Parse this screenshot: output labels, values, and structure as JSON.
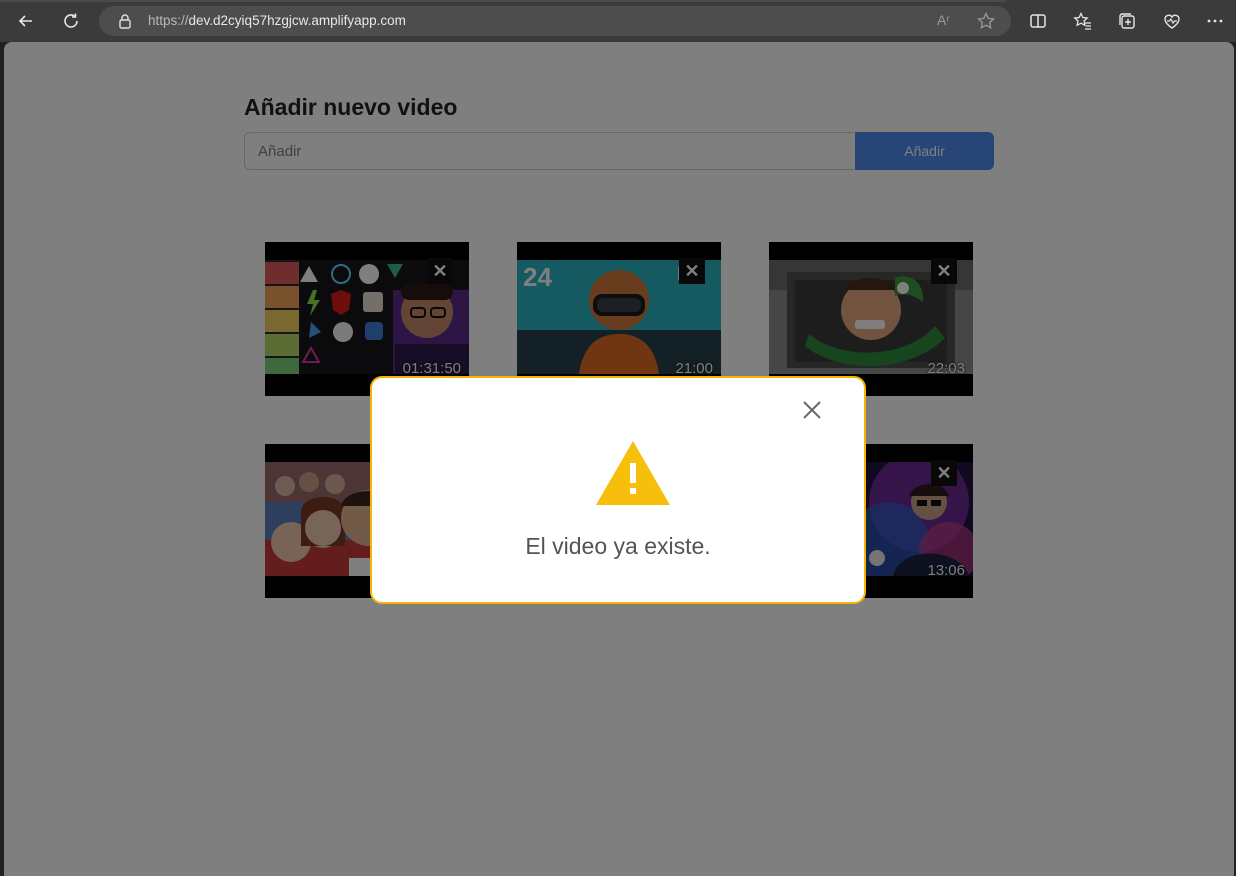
{
  "browser": {
    "url_scheme": "https://",
    "url_host": "dev.d2cyiq57hzgjcw.amplifyapp.com",
    "read_aloud_label": "Aʳ"
  },
  "page": {
    "heading": "Añadir nuevo video",
    "input_placeholder": "Añadir",
    "add_button_label": "Añadir"
  },
  "videos": [
    {
      "duration": "01:31:50",
      "delete_label": "✕"
    },
    {
      "duration": "21:00",
      "delete_label": "✕"
    },
    {
      "duration": "22:03",
      "delete_label": "✕"
    },
    {
      "duration": "",
      "delete_label": ""
    },
    {
      "duration": "",
      "delete_label": ""
    },
    {
      "duration": "13:06",
      "delete_label": "✕"
    }
  ],
  "modal": {
    "message": "El video ya existe.",
    "icon": "warning-icon",
    "border_color": "#f4b400"
  }
}
